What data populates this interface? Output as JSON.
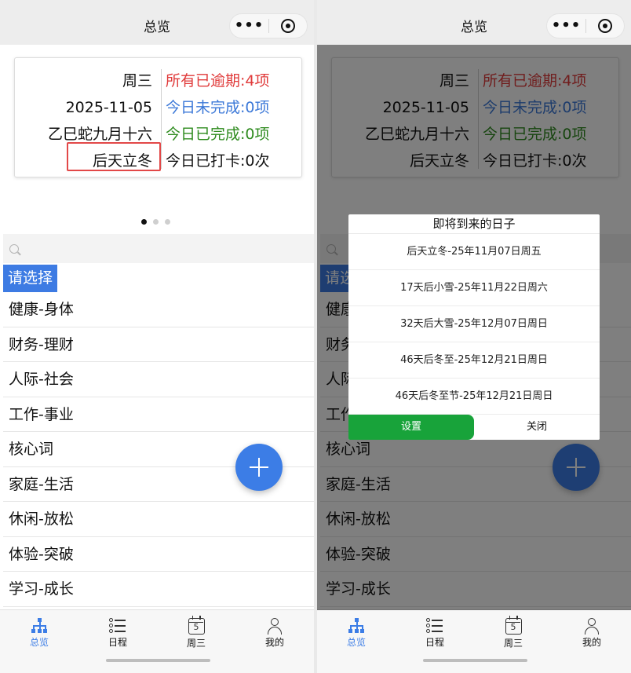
{
  "header": {
    "title": "总览",
    "more_label": "•••"
  },
  "summary": {
    "left": [
      "周三",
      "2025-11-05",
      "乙巳蛇九月十六",
      "后天立冬"
    ],
    "right": [
      {
        "text": "所有已逾期:4项",
        "color": "#e03a3a"
      },
      {
        "text": "今日未完成:0项",
        "color": "#3b78d8"
      },
      {
        "text": "今日已完成:0项",
        "color": "#2e8b1e"
      },
      {
        "text": "今日已打卡:0次",
        "color": "#111111"
      }
    ]
  },
  "search": {
    "placeholder": ""
  },
  "categories": {
    "select_label": "请选择",
    "items": [
      "健康-身体",
      "财务-理财",
      "人际-社会",
      "工作-事业",
      "核心词",
      "家庭-生活",
      "休闲-放松",
      "体验-突破",
      "学习-成长"
    ]
  },
  "tabbar": {
    "tabs": [
      {
        "label": "总览",
        "icon": "tree-icon"
      },
      {
        "label": "日程",
        "icon": "list-icon"
      },
      {
        "label": "周三",
        "icon": "calendar-icon",
        "day": "5"
      },
      {
        "label": "我的",
        "icon": "user-icon"
      }
    ]
  },
  "dialog": {
    "title": "即将到来的日子",
    "items": [
      "后天立冬-25年11月07日周五",
      "17天后小雪-25年11月22日周六",
      "32天后大雪-25年12月07日周日",
      "46天后冬至-25年12月21日周日",
      "46天后冬至节-25年12月21日周日"
    ],
    "set_label": "设置",
    "close_label": "关闭"
  },
  "colors": {
    "accent": "#3c7de6",
    "overdue": "#e03a3a",
    "pending": "#3b78d8",
    "done": "#2e8b1e",
    "confirm": "#18a33a",
    "highlight": "#e24848"
  }
}
